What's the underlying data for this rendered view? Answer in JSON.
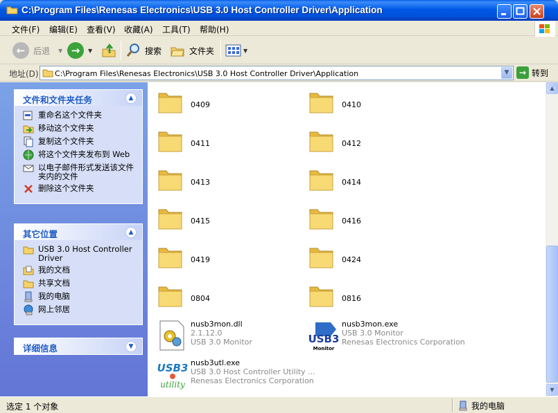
{
  "window": {
    "title": "C:\\Program Files\\Renesas Electronics\\USB 3.0 Host Controller Driver\\Application"
  },
  "menu": [
    "文件(F)",
    "编辑(E)",
    "查看(V)",
    "收藏(A)",
    "工具(T)",
    "帮助(H)"
  ],
  "toolbar": {
    "back_label": "后退",
    "search_label": "搜索",
    "folders_label": "文件夹"
  },
  "address": {
    "label": "地址(D)",
    "value": "C:\\Program Files\\Renesas Electronics\\USB 3.0 Host Controller Driver\\Application",
    "go_label": "转到"
  },
  "tasks_panel": {
    "title": "文件和文件夹任务",
    "items": [
      {
        "label": "重命名这个文件夹",
        "icon": "rename-icon"
      },
      {
        "label": "移动这个文件夹",
        "icon": "move-icon"
      },
      {
        "label": "复制这个文件夹",
        "icon": "copy-icon"
      },
      {
        "label": "将这个文件夹发布到 Web",
        "icon": "publish-web-icon"
      },
      {
        "label": "以电子邮件形式发送该文件夹内的文件",
        "icon": "email-icon"
      },
      {
        "label": "删除这个文件夹",
        "icon": "delete-icon"
      }
    ]
  },
  "places_panel": {
    "title": "其它位置",
    "items": [
      {
        "label": "USB 3.0 Host Controller Driver",
        "icon": "folder-icon"
      },
      {
        "label": "我的文档",
        "icon": "my-documents-icon"
      },
      {
        "label": "共享文档",
        "icon": "shared-documents-icon"
      },
      {
        "label": "我的电脑",
        "icon": "my-computer-icon"
      },
      {
        "label": "网上邻居",
        "icon": "network-places-icon"
      }
    ]
  },
  "details_panel": {
    "title": "详细信息"
  },
  "folders": [
    "0409",
    "0410",
    "0411",
    "0412",
    "0413",
    "0414",
    "0415",
    "0416",
    "0419",
    "0424",
    "0804",
    "0816"
  ],
  "files": [
    {
      "name": "nusb3mon.dll",
      "line2": "2.1.12.0",
      "line3": "USB 3.0 Monitor",
      "icon": "dll-icon"
    },
    {
      "name": "nusb3mon.exe",
      "line2": "USB 3.0 Monitor",
      "line3": "Renesas Electronics Corporation",
      "icon": "usb3-monitor-icon",
      "icon_text": "USB3",
      "icon_sub": "Monitor"
    },
    {
      "name": "nusb3utl.exe",
      "line2": "USB 3.0 Host Controller Utility ...",
      "line3": "Renesas Electronics Corporation",
      "icon": "usb3-utility-icon",
      "icon_text": "USB3",
      "icon_sub": "utility"
    }
  ],
  "status": {
    "left": "选定 1 个对象",
    "right": "我的电脑"
  },
  "colors": {
    "titlebar": "#0058E6",
    "taskpane": "#6375D6",
    "panel_head_text": "#215DC6",
    "folder": "#F5D36A"
  }
}
